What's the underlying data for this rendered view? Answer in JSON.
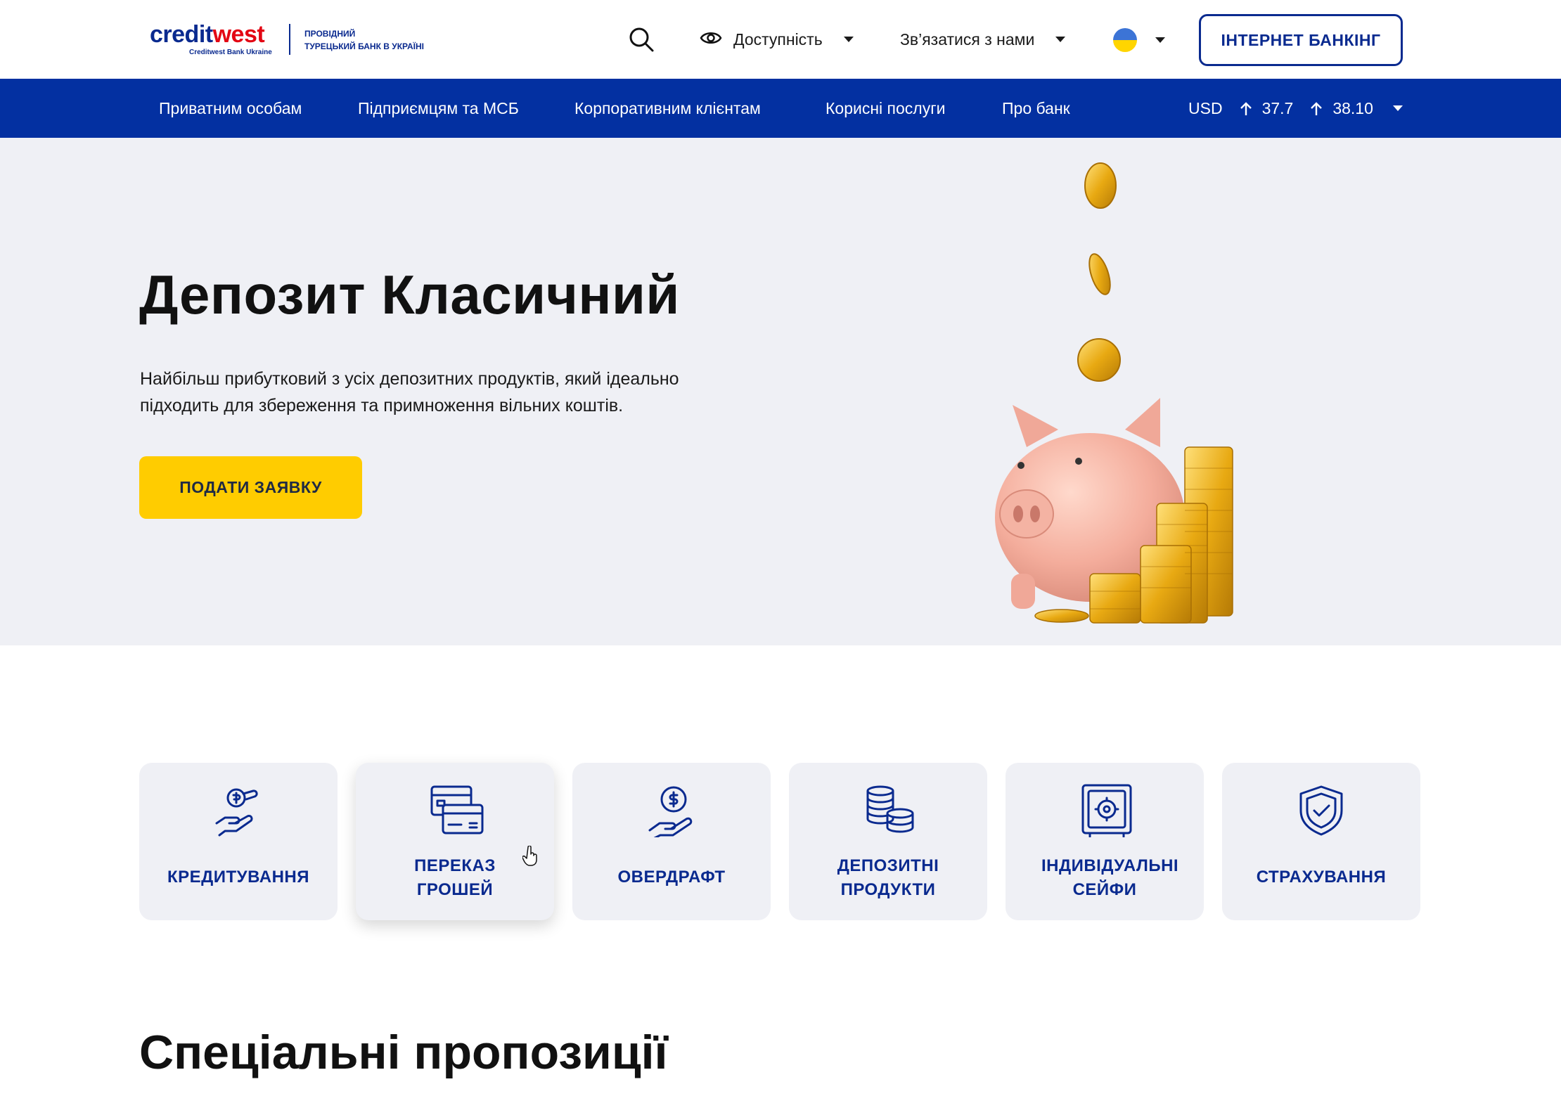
{
  "header": {
    "logo_part1": "credit",
    "logo_part2": "west",
    "logo_sub": "Creditwest Bank Ukraine",
    "logo_tag_line1": "ПРОВІДНИЙ",
    "logo_tag_line2": "ТУРЕЦЬКИЙ БАНК В УКРАЇНІ",
    "accessibility_label": "Доступність",
    "contact_label": "Зв’язатися з нами",
    "internet_banking_label": "ІНТЕРНЕТ БАНКІНГ"
  },
  "nav": {
    "items": [
      "Приватним особам",
      "Підприємцям та МСБ",
      "Корпоративним клієнтам",
      "Корисні послуги",
      "Про банк"
    ],
    "currency": "USD",
    "buy_rate": "37.7",
    "sell_rate": "38.10"
  },
  "hero": {
    "title": "Депозит Класичний",
    "description_line1": "Найбільш прибутковий з усіх депозитних продуктів, який ідеально",
    "description_line2": "підходить для збереження та примноження вільних коштів.",
    "apply_label": "ПОДАТИ ЗАЯВКУ"
  },
  "services": [
    {
      "line1": "КРЕДИТУВАННЯ",
      "line2": "",
      "icon": "hand-money-icon"
    },
    {
      "line1": "ПЕРЕКАЗ",
      "line2": "ГРОШЕЙ",
      "icon": "cards-transfer-icon"
    },
    {
      "line1": "ОВЕРДРАФТ",
      "line2": "",
      "icon": "hand-dollar-coin-icon"
    },
    {
      "line1": "ДЕПОЗИТНІ",
      "line2": "ПРОДУКТИ",
      "icon": "coin-stack-icon"
    },
    {
      "line1": "ІНДИВІДУАЛЬНІ",
      "line2": "СЕЙФИ",
      "icon": "safe-icon"
    },
    {
      "line1": "СТРАХУВАННЯ",
      "line2": "",
      "icon": "shield-check-icon"
    }
  ],
  "special_offers_title": "Спеціальні пропозиції",
  "colors": {
    "brand_blue": "#0330a1",
    "accent_yellow": "#ffcc00",
    "hero_bg": "#eff0f5",
    "card_bg": "#eff0f5"
  }
}
